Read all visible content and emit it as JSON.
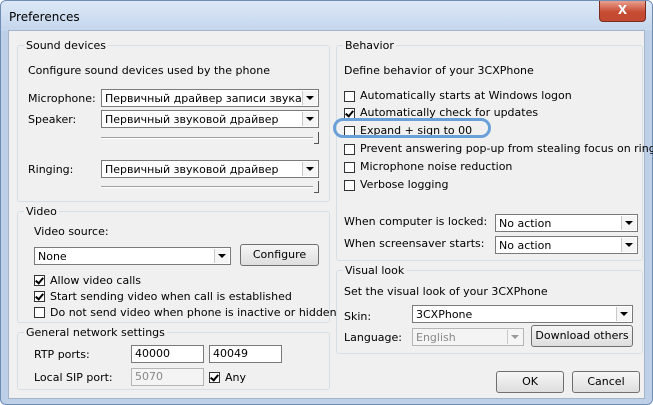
{
  "window": {
    "title": "Preferences",
    "close_label": "X"
  },
  "sound": {
    "legend": "Sound devices",
    "description": "Configure sound devices used by the phone",
    "microphone_label": "Microphone:",
    "microphone_value": "Первичный драйвер записи звука",
    "speaker_label": "Speaker:",
    "speaker_value": "Первичный звуковой драйвер",
    "ringing_label": "Ringing:",
    "ringing_value": "Первичный звуковой драйвер"
  },
  "video": {
    "legend": "Video",
    "source_label": "Video source:",
    "source_value": "None",
    "configure_label": "Configure",
    "options": [
      {
        "label": "Allow video calls",
        "checked": true
      },
      {
        "label": "Start sending video when call is established",
        "checked": true
      },
      {
        "label": "Do not send video when phone is inactive or hidden",
        "checked": false
      }
    ]
  },
  "network": {
    "legend": "General network settings",
    "rtp_label": "RTP ports:",
    "rtp_from": "40000",
    "rtp_to": "40049",
    "sip_label": "Local SIP port:",
    "sip_value": "5070",
    "any_label": "Any",
    "any_checked": true
  },
  "behavior": {
    "legend": "Behavior",
    "description": "Define behavior of your 3CXPhone",
    "options": [
      {
        "label": "Automatically starts at Windows logon",
        "checked": false
      },
      {
        "label": "Automatically check for updates",
        "checked": true
      },
      {
        "label": "Expand + sign to 00",
        "checked": false
      },
      {
        "label": "Prevent answering pop-up from stealing focus on ringing",
        "checked": false
      },
      {
        "label": "Microphone noise reduction",
        "checked": false
      },
      {
        "label": "Verbose logging",
        "checked": false
      }
    ],
    "locked_label": "When computer is locked:",
    "locked_value": "No action",
    "screensaver_label": "When screensaver starts:",
    "screensaver_value": "No action"
  },
  "visual": {
    "legend": "Visual look",
    "description": "Set the visual look of your 3CXPhone",
    "skin_label": "Skin:",
    "skin_value": "3CXPhone",
    "language_label": "Language:",
    "language_value": "English",
    "download_label": "Download others"
  },
  "footer": {
    "ok_label": "OK",
    "cancel_label": "Cancel"
  },
  "colors": {
    "highlight": "#6aa0d8",
    "titlebar": "#c4d6ed",
    "close": "#c74b33"
  }
}
